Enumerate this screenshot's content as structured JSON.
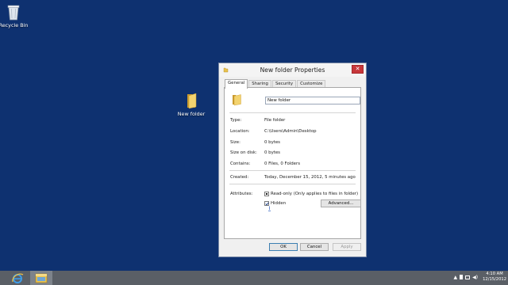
{
  "desktop": {
    "recycle_bin_label": "Recycle Bin",
    "new_folder_label": "New folder"
  },
  "dialog": {
    "title": "New folder Properties",
    "close_glyph": "✕",
    "tabs": [
      {
        "label": "General"
      },
      {
        "label": "Sharing"
      },
      {
        "label": "Security"
      },
      {
        "label": "Customize"
      }
    ],
    "folder_name": "New folder",
    "fields": {
      "type_label": "Type:",
      "type_value": "File folder",
      "location_label": "Location:",
      "location_value": "C:\\Users\\Admin\\Desktop",
      "size_label": "Size:",
      "size_value": "0 bytes",
      "size_on_disk_label": "Size on disk:",
      "size_on_disk_value": "0 bytes",
      "contains_label": "Contains:",
      "contains_value": "0 Files, 0 Folders",
      "created_label": "Created:",
      "created_value": "Today, December 15, 2012, 5 minutes ago",
      "attributes_label": "Attributes:"
    },
    "attributes": {
      "readonly_label": "Read-only (Only applies to files in folder)",
      "readonly_state": "indeterminate",
      "hidden_label": "Hidden",
      "hidden_checked": true,
      "advanced_label": "Advanced..."
    },
    "buttons": {
      "ok": "OK",
      "cancel": "Cancel",
      "apply": "Apply"
    }
  },
  "taskbar": {
    "time": "4:10 AM",
    "date": "12/15/2012"
  },
  "colors": {
    "desktop_bg": "#0e3170",
    "taskbar_bg": "#5a5f66",
    "close_button": "#c7373a",
    "folder_yellow": "#e8c24e"
  }
}
